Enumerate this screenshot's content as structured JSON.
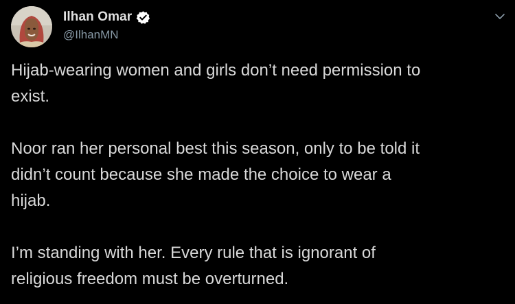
{
  "author": {
    "display_name": "Ilhan Omar",
    "handle": "@IlhanMN",
    "verified": true,
    "avatar_icon": "profile-photo"
  },
  "menu_icon": "chevron-down-icon",
  "tweet": {
    "paragraphs": [
      "Hijab-wearing women and girls don’t need permission to\nexist.",
      "Noor ran her personal best this season, only to be told it\ndidn’t count because she made the choice to wear a\nhijab.",
      "I’m standing with her. Every rule that is ignorant of\nreligious freedom must be overturned."
    ]
  },
  "colors": {
    "background": "#000000",
    "text": "#d9d9d9",
    "handle": "#8899a6",
    "verified_badge": "#ffffff"
  }
}
